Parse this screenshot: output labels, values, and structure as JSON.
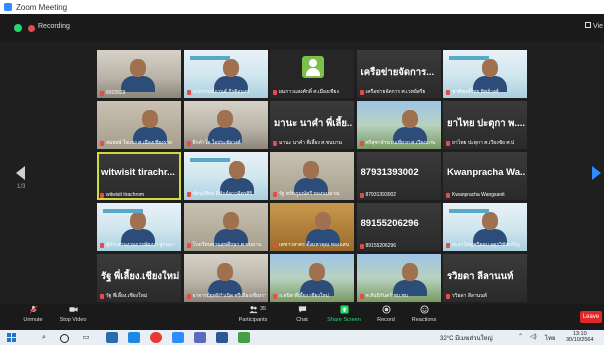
{
  "window": {
    "title": "Zoom Meeting",
    "min_glyph": "—",
    "max_glyph": "☐",
    "close_glyph": "✕"
  },
  "meeting_bar": {
    "recording_label": "Recording",
    "view_label": "Vie",
    "page_indicator": "1/3"
  },
  "participants": [
    {
      "name": "8915529",
      "video": "room",
      "big_text": ""
    },
    {
      "name": "นายวรรณ์กานต์ กีรติอนงค์",
      "video": "blueslide",
      "big_text": ""
    },
    {
      "name": "ผมกาวแสงศักดิ์ ศ.เมืองเชียง",
      "video": "avatar",
      "big_text": ""
    },
    {
      "name": "เครือข่ายจัดการ ศ.เวทย์สรีย",
      "video": "dark",
      "big_text": "เครือข่ายจัดการ..."
    },
    {
      "name": "ชาติพงษ์ไทย ทิพย์วงศ์",
      "video": "blueslide",
      "big_text": ""
    },
    {
      "name": "สมพงษ์ ใจแจง ศ.เมืองเชียงราย",
      "video": "office",
      "big_text": ""
    },
    {
      "name": "ยึกคำโต ใจประชัยวงศ์",
      "video": "room",
      "big_text": ""
    },
    {
      "name": "มานะ นาคำ พี่เลี้ยง ศ.ชนบาน",
      "video": "dark",
      "big_text": "มานะ นาคำ พี่เลี้ย..."
    },
    {
      "name": "ศรีสุชาจำนวนเที่ยวก ศ.เวียงแก่น",
      "video": "outdoor",
      "big_text": ""
    },
    {
      "name": "ยาไทย ปะตุกา ศ.เวียงชัย ศ.ป",
      "video": "dark",
      "big_text": "ยาไทย ปะตุกา พ...."
    },
    {
      "name": "witwisit tirachrom",
      "video": "dark",
      "big_text": "witwisit tirachr...",
      "active": true
    },
    {
      "name": "ขัดนุปัติจง ดีพันธ์ดาวจิตรศิริ",
      "video": "blueslide",
      "big_text": ""
    },
    {
      "name": "รัฐ ตรัทภูมณ์ศรี ทองนมมาณ",
      "video": "office",
      "big_text": ""
    },
    {
      "name": "87931393002",
      "video": "dark",
      "big_text": "87931393002"
    },
    {
      "name": "Kwanpracha Wangsanit",
      "video": "dark",
      "big_text": "Kwanpracha Wa..."
    },
    {
      "name": "ผู้ประสานงานการพัฒนา ลูกมนา",
      "video": "blueslide",
      "big_text": ""
    },
    {
      "name": "โรงเรียนพานสุขศึกษา ศ.ชนบาน",
      "video": "office",
      "big_text": ""
    },
    {
      "name": "เตชาวสาคร ตั้งมหาคุณ ทองแสน",
      "video": "orange",
      "big_text": ""
    },
    {
      "name": "89155206296",
      "video": "dark",
      "big_text": "89155206296"
    },
    {
      "name": "ยะลาใหญ่ศรีตอบ จตุรวิชัยเจริญ",
      "video": "blueslide",
      "big_text": ""
    },
    {
      "name": "รัฐ พี่เลี้ยง.เชียงใหม่",
      "video": "dark",
      "big_text": "รัฐ พี่เลี้ยง.เชียงใหม่"
    },
    {
      "name": "อาจารย์ยุทธิกำเนิด ศรีเมืองเชียงรา",
      "video": "room",
      "big_text": ""
    },
    {
      "name": "อ.สนิท พี่เลี้ยง.เชียงใหม่",
      "video": "outdoor",
      "big_text": ""
    },
    {
      "name": "ศ.สันนิรันดร์ ชบ.ชบ",
      "video": "outdoor",
      "big_text": ""
    },
    {
      "name": "รวิยดา ลีลานนท์",
      "video": "dark",
      "big_text": "รวิยดา ลีลานนท์"
    }
  ],
  "toolbar": {
    "unmute": "Unmute",
    "stop_video": "Stop Video",
    "participants": "Participants",
    "participant_count": "35",
    "chat": "Chat",
    "share_screen": "Share Screen",
    "record": "Record",
    "reactions": "Reactions",
    "leave": "Leave"
  },
  "taskbar": {
    "temperature": "32°C มีเมฆส่วนใหญ่",
    "lang": "ไทย",
    "time": "13:10",
    "date": "30/10/2564"
  },
  "colors": {
    "accent_blue": "#2d8cff",
    "share_green": "#23d96b",
    "leave_red": "#e02828",
    "active_outline": "#cddc39"
  }
}
